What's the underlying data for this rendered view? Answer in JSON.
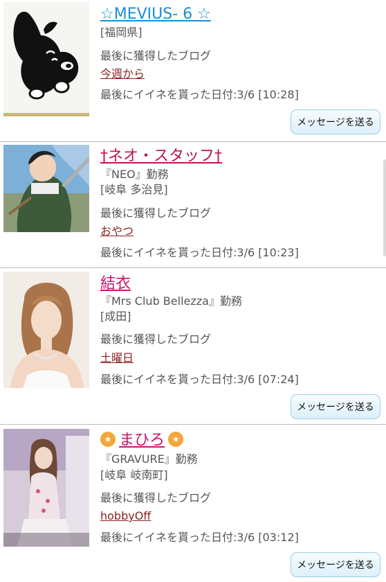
{
  "colors": {
    "link_blue": "#1a8fd6",
    "link_red": "#c0154f",
    "link_pink": "#c2186b",
    "blog_link": "#8b1f1f",
    "button_border": "#9ccde6"
  },
  "labels": {
    "last_blog": "最後に獲得したブログ",
    "message_button": "メッセージを送る"
  },
  "users": [
    {
      "name": "☆MEVIUS- 6 ☆",
      "shop": "",
      "area": "[福岡県]",
      "blog_title": "今週から",
      "last_like": "最後にイイネを貰った日付:3/6 [10:28]",
      "avatar_icon": "black-dog-icon"
    },
    {
      "name": "†ネオ・スタッフ†",
      "shop": "『NEO』勤務",
      "area": "[岐阜 多治見]",
      "blog_title": "おやつ",
      "last_like": "最後にイイネを貰った日付:3/6 [10:23]",
      "avatar_icon": "anime-soldier-icon"
    },
    {
      "name": "結衣",
      "shop": "『Mrs Club Bellezza』勤務",
      "area": "[成田]",
      "blog_title": "土曜日",
      "last_like": "最後にイイネを貰った日付:3/6 [07:24]",
      "avatar_icon": "woman-portrait-icon"
    },
    {
      "name": "まひろ",
      "shop": "『GRAVURE』勤務",
      "area": "[岐阜 岐南町]",
      "blog_title": "hobbyOff",
      "last_like": "最後にイイネを貰った日付:3/6 [03:12]",
      "avatar_icon": "woman-photo-icon"
    }
  ]
}
